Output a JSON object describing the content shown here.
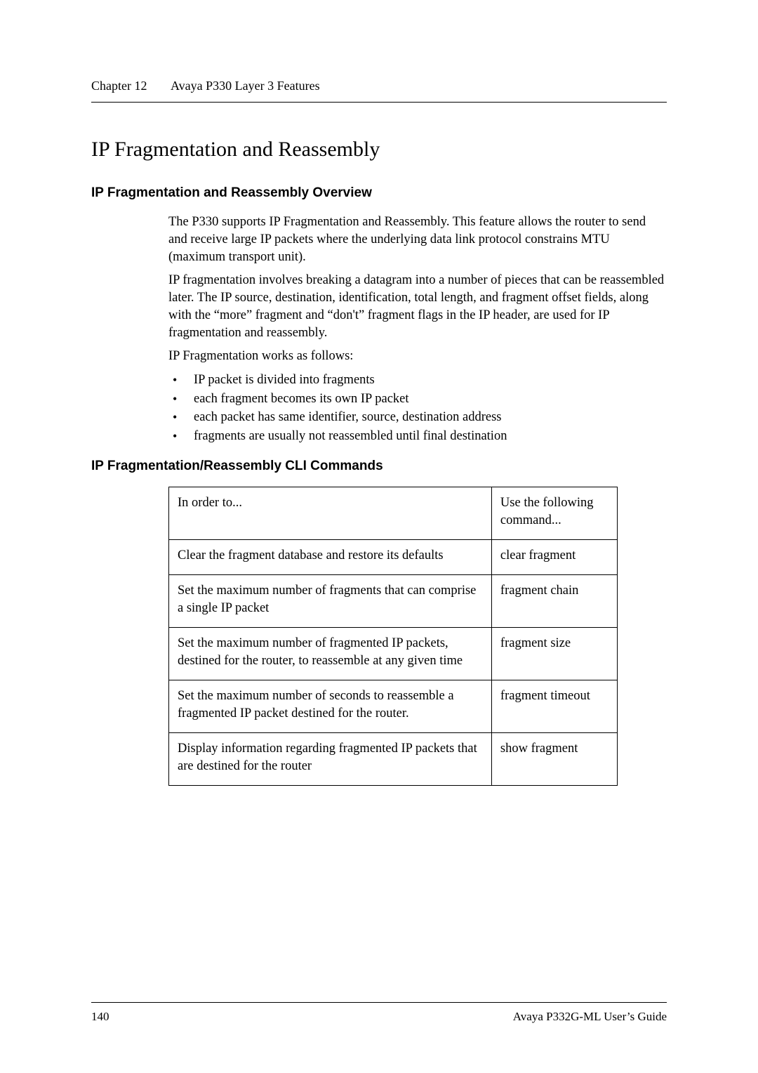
{
  "header": {
    "chapter_label": "Chapter 12",
    "chapter_title": "Avaya P330 Layer 3 Features"
  },
  "section_title": "IP Fragmentation and Reassembly",
  "overview": {
    "heading": "IP Fragmentation and Reassembly Overview",
    "para1": "The P330 supports IP Fragmentation and Reassembly. This feature allows the router to send and receive large IP packets where the underlying data link protocol constrains MTU (maximum transport unit).",
    "para2": "IP fragmentation involves breaking a datagram into a number of pieces that can be reassembled later. The IP source, destination, identification, total length, and fragment offset fields, along with the “more” fragment and “don't” fragment flags in the IP header, are used for IP fragmentation and reassembly.",
    "para3": "IP Fragmentation works as follows:",
    "bullets": [
      "IP packet is divided into fragments",
      "each fragment becomes its own IP packet",
      "each packet has same identifier, source, destination address",
      "fragments are usually not reassembled until final destination"
    ]
  },
  "cli": {
    "heading": "IP Fragmentation/Reassembly CLI Commands",
    "col1": "In order to...",
    "col2": "Use the following command...",
    "rows": [
      {
        "desc": "Clear the fragment database and restore its defaults",
        "cmd": "clear fragment"
      },
      {
        "desc": "Set the maximum number of fragments that can comprise a single IP packet",
        "cmd": "fragment chain"
      },
      {
        "desc": "Set the maximum number of fragmented IP packets, destined for the router, to reassemble at any given time",
        "cmd": "fragment size"
      },
      {
        "desc": "Set the maximum number of seconds to reassemble a fragmented IP packet destined for the router.",
        "cmd": "fragment timeout"
      },
      {
        "desc": "Display information regarding fragmented IP packets that are destined for the router",
        "cmd": "show fragment"
      }
    ]
  },
  "footer": {
    "page": "140",
    "doc": "Avaya P332G-ML User’s Guide"
  }
}
